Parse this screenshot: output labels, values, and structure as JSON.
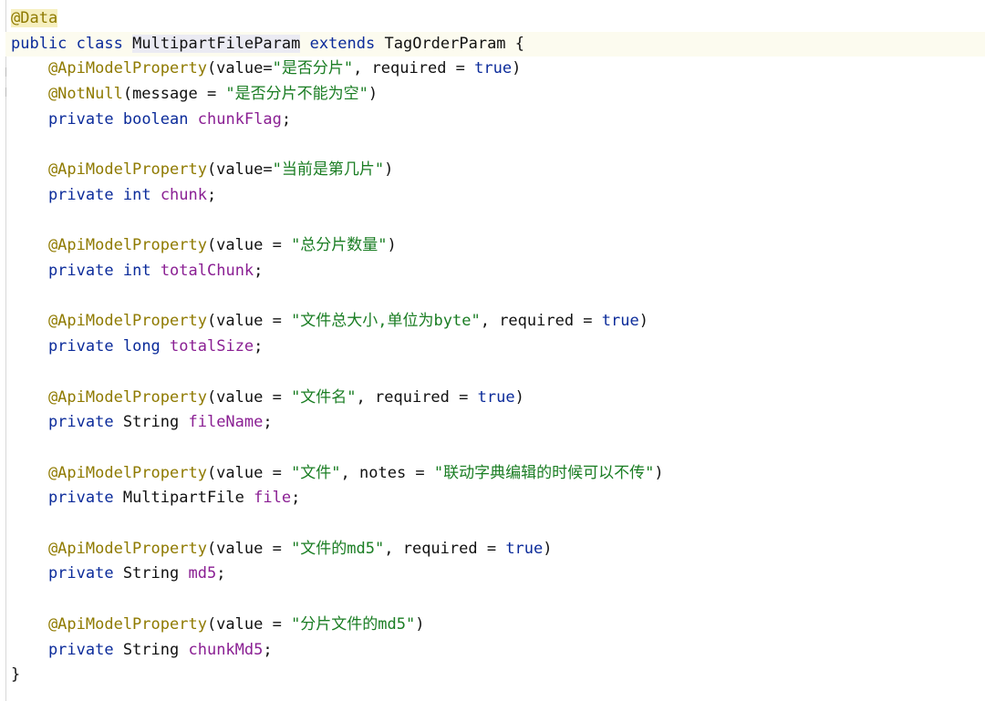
{
  "editor": {
    "language": "java",
    "colors": {
      "background": "#ffffff",
      "current_line": "#fcfbef",
      "annotation": "#8f7a00",
      "keyword": "#0b2b9a",
      "field": "#8a1f93",
      "string": "#1a7d23",
      "plain": "#111111"
    },
    "lines": [
      [
        {
          "t": "@Data",
          "c": "annotation-hl annotation"
        }
      ],
      [
        {
          "t": "public",
          "c": "keyword"
        },
        {
          "t": " ",
          "c": "plain"
        },
        {
          "t": "class",
          "c": "keyword"
        },
        {
          "t": " ",
          "c": "plain"
        },
        {
          "t": "MultipartFileParam",
          "c": "type type-hl"
        },
        {
          "t": " ",
          "c": "plain"
        },
        {
          "t": "extends",
          "c": "keyword"
        },
        {
          "t": " TagOrderParam {",
          "c": "plain"
        }
      ],
      [
        {
          "t": "    @ApiModelProperty",
          "c": "annotation"
        },
        {
          "t": "(value=",
          "c": "plain"
        },
        {
          "t": "\"是否分片\"",
          "c": "string"
        },
        {
          "t": ", required = ",
          "c": "plain"
        },
        {
          "t": "true",
          "c": "keyword"
        },
        {
          "t": ")",
          "c": "plain"
        }
      ],
      [
        {
          "t": "    @NotNull",
          "c": "annotation"
        },
        {
          "t": "(message = ",
          "c": "plain"
        },
        {
          "t": "\"是否分片不能为空\"",
          "c": "string"
        },
        {
          "t": ")",
          "c": "plain"
        }
      ],
      [
        {
          "t": "    private",
          "c": "keyword"
        },
        {
          "t": " ",
          "c": "plain"
        },
        {
          "t": "boolean",
          "c": "keyword"
        },
        {
          "t": " ",
          "c": "plain"
        },
        {
          "t": "chunkFlag",
          "c": "field"
        },
        {
          "t": ";",
          "c": "plain"
        }
      ],
      [],
      [
        {
          "t": "    @ApiModelProperty",
          "c": "annotation"
        },
        {
          "t": "(value=",
          "c": "plain"
        },
        {
          "t": "\"当前是第几片\"",
          "c": "string"
        },
        {
          "t": ")",
          "c": "plain"
        }
      ],
      [
        {
          "t": "    private",
          "c": "keyword"
        },
        {
          "t": " ",
          "c": "plain"
        },
        {
          "t": "int",
          "c": "keyword"
        },
        {
          "t": " ",
          "c": "plain"
        },
        {
          "t": "chunk",
          "c": "field"
        },
        {
          "t": ";",
          "c": "plain"
        }
      ],
      [],
      [
        {
          "t": "    @ApiModelProperty",
          "c": "annotation"
        },
        {
          "t": "(value = ",
          "c": "plain"
        },
        {
          "t": "\"总分片数量\"",
          "c": "string"
        },
        {
          "t": ")",
          "c": "plain"
        }
      ],
      [
        {
          "t": "    private",
          "c": "keyword"
        },
        {
          "t": " ",
          "c": "plain"
        },
        {
          "t": "int",
          "c": "keyword"
        },
        {
          "t": " ",
          "c": "plain"
        },
        {
          "t": "totalChunk",
          "c": "field"
        },
        {
          "t": ";",
          "c": "plain"
        }
      ],
      [],
      [
        {
          "t": "    @ApiModelProperty",
          "c": "annotation"
        },
        {
          "t": "(value = ",
          "c": "plain"
        },
        {
          "t": "\"文件总大小,单位为byte\"",
          "c": "string"
        },
        {
          "t": ", required = ",
          "c": "plain"
        },
        {
          "t": "true",
          "c": "keyword"
        },
        {
          "t": ")",
          "c": "plain"
        }
      ],
      [
        {
          "t": "    private",
          "c": "keyword"
        },
        {
          "t": " ",
          "c": "plain"
        },
        {
          "t": "long",
          "c": "keyword"
        },
        {
          "t": " ",
          "c": "plain"
        },
        {
          "t": "totalSize",
          "c": "field"
        },
        {
          "t": ";",
          "c": "plain"
        }
      ],
      [],
      [
        {
          "t": "    @ApiModelProperty",
          "c": "annotation"
        },
        {
          "t": "(value = ",
          "c": "plain"
        },
        {
          "t": "\"文件名\"",
          "c": "string"
        },
        {
          "t": ", required = ",
          "c": "plain"
        },
        {
          "t": "true",
          "c": "keyword"
        },
        {
          "t": ")",
          "c": "plain"
        }
      ],
      [
        {
          "t": "    private",
          "c": "keyword"
        },
        {
          "t": " String ",
          "c": "plain"
        },
        {
          "t": "fileName",
          "c": "field"
        },
        {
          "t": ";",
          "c": "plain"
        }
      ],
      [],
      [
        {
          "t": "    @ApiModelProperty",
          "c": "annotation"
        },
        {
          "t": "(value = ",
          "c": "plain"
        },
        {
          "t": "\"文件\"",
          "c": "string"
        },
        {
          "t": ", notes = ",
          "c": "plain"
        },
        {
          "t": "\"联动字典编辑的时候可以不传\"",
          "c": "string"
        },
        {
          "t": ")",
          "c": "plain"
        }
      ],
      [
        {
          "t": "    private",
          "c": "keyword"
        },
        {
          "t": " MultipartFile ",
          "c": "plain"
        },
        {
          "t": "file",
          "c": "field"
        },
        {
          "t": ";",
          "c": "plain"
        }
      ],
      [],
      [
        {
          "t": "    @ApiModelProperty",
          "c": "annotation"
        },
        {
          "t": "(value = ",
          "c": "plain"
        },
        {
          "t": "\"文件的md5\"",
          "c": "string"
        },
        {
          "t": ", required = ",
          "c": "plain"
        },
        {
          "t": "true",
          "c": "keyword"
        },
        {
          "t": ")",
          "c": "plain"
        }
      ],
      [
        {
          "t": "    private",
          "c": "keyword"
        },
        {
          "t": " String ",
          "c": "plain"
        },
        {
          "t": "md5",
          "c": "field"
        },
        {
          "t": ";",
          "c": "plain"
        }
      ],
      [],
      [
        {
          "t": "    @ApiModelProperty",
          "c": "annotation"
        },
        {
          "t": "(value = ",
          "c": "plain"
        },
        {
          "t": "\"分片文件的md5\"",
          "c": "string"
        },
        {
          "t": ")",
          "c": "plain"
        }
      ],
      [
        {
          "t": "    private",
          "c": "keyword"
        },
        {
          "t": " String ",
          "c": "plain"
        },
        {
          "t": "chunkMd5",
          "c": "field"
        },
        {
          "t": ";",
          "c": "plain"
        }
      ],
      [
        {
          "t": "}",
          "c": "plain"
        }
      ]
    ]
  }
}
